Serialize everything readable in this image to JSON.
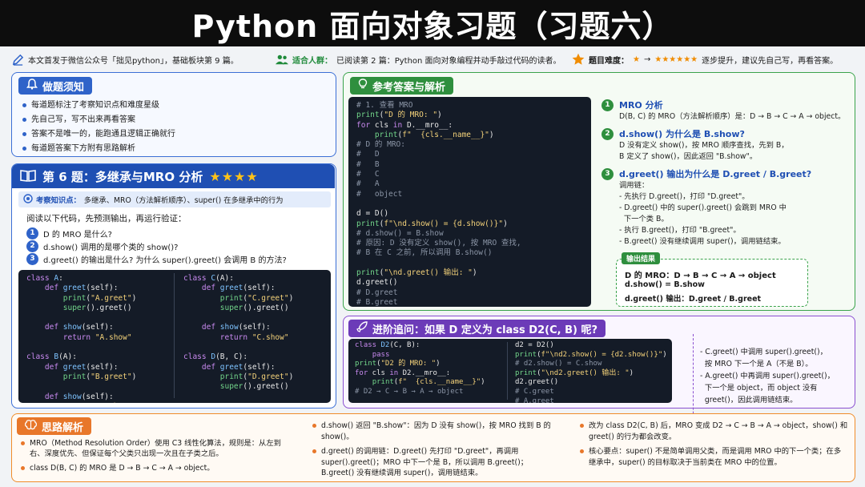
{
  "header": {
    "title": "Python 面向对象习题（习题六）"
  },
  "infobar": {
    "source": "本文首发于微信公众号「拙见python」，基础板块第 9 篇。",
    "audience_label": "适合人群：",
    "audience_text": "已阅读第 2 篇：Python 面向对象编程并动手敲过代码的读者。",
    "difficulty_label": "题目难度：",
    "difficulty_from": "★",
    "difficulty_arrow": "→",
    "difficulty_to": "★★★★★★",
    "difficulty_text": "逐步提升，建议先自己写，再看答案。"
  },
  "notice": {
    "title": "做题须知",
    "items": [
      "每道题标注了考察知识点和难度星级",
      "先自己写，写不出来再看答案",
      "答案不是唯一的，能跑通且逻辑正确就行",
      "每道题答案下方附有思路解析"
    ]
  },
  "question": {
    "title": "第 6 题：多继承与MRO 分析",
    "stars": "★★★★",
    "topic_label": "考察知识点：",
    "topic_text": "多继承、MRO（方法解析顺序）、super() 在多继承中的行为",
    "intro": "阅读以下代码，先预测输出，再运行验证：",
    "items": [
      "D 的 MRO 是什么?",
      "d.show() 调用的是哪个类的 show()?",
      "d.greet() 的输出是什么? 为什么 super().greet() 会调用 B 的方法?"
    ]
  },
  "answer": {
    "title": "参考答案与解析",
    "sections": [
      {
        "num": "1",
        "title": "MRO 分析",
        "lines": [
          "D(B, C) 的 MRO（方法解析顺序）是：D → B → C → A → object。"
        ]
      },
      {
        "num": "2",
        "title": "d.show() 为什么是 B.show?",
        "lines": [
          "D 没有定义 show()，按 MRO 顺序查找，先到 B，",
          "B 定义了 show()，因此返回 \"B.show\"。"
        ]
      },
      {
        "num": "3",
        "title": "d.greet() 输出为什么是 D.greet / B.greet?",
        "lines": [
          "调用链：",
          "- 先执行 D.greet()，打印 \"D.greet\"。",
          "- D.greet() 中的 super().greet() 会跳到 MRO 中",
          "  下一个类 B。",
          "- 执行 B.greet()，打印 \"B.greet\"。",
          "- B.greet() 没有继续调用 super()，调用链结束。"
        ]
      }
    ],
    "result_label": "输出结果",
    "results": [
      "D 的 MRO：D → B → C → A → object",
      "d.show() = B.show",
      "d.greet() 输出：D.greet / B.greet"
    ]
  },
  "advanced": {
    "title": "进阶追问：如果 D 定义为 class D2(C, B) 呢?",
    "notes": [
      "- C.greet() 中调用 super().greet()，",
      "  按 MRO 下一个是 A（不是 B）。",
      "- A.greet() 中再调用 super().greet()，",
      "  下一个是 object，而 object 没有",
      "  greet()，因此调用链结束。"
    ]
  },
  "thinking": {
    "title": "思路解析",
    "col1": [
      "MRO（Method Resolution Order）使用 C3 线性化算法，规则是：从左到右、深度优先、但保证每个父类只出现一次且在子类之后。",
      "class D(B, C) 的 MRO 是 D → B → C → A → object。"
    ],
    "col2": [
      "d.show() 返回 \"B.show\"：因为 D 没有 show()，按 MRO 找到 B 的 show()。",
      "d.greet() 的调用链：D.greet() 先打印 \"D.greet\"，再调用 super().greet()；MRO 中下一个是 B，所以调用 B.greet()；B.greet() 没有继续调用 super()，调用链结束。"
    ],
    "col3": [
      "改为 class D2(C, B) 后，MRO 变成 D2 → C → B → A → object，show() 和 greet() 的行为都会改变。",
      "核心要点：super() 不是简单调用父类，而是调用 MRO 中的下一个类；在多继承中，super() 的目标取决于当前类在 MRO 中的位置。"
    ]
  }
}
